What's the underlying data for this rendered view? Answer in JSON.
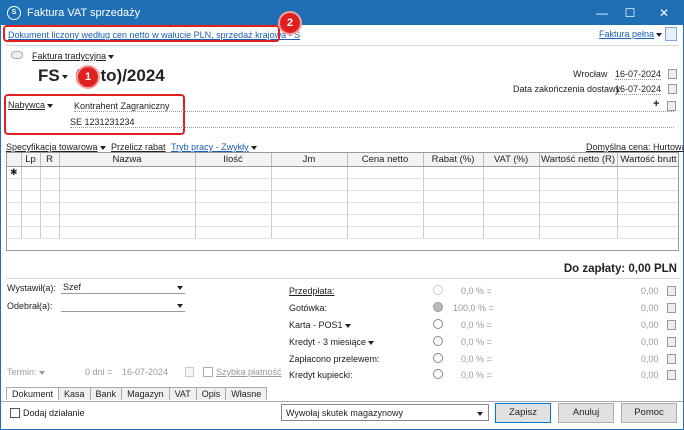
{
  "window": {
    "title": "Faktura VAT sprzedaży"
  },
  "doc_info": "Dokument liczony według cen netto w walucie PLN, sprzedaż krajowa - S",
  "faktura_pelna": "Faktura pełna",
  "faktura_tradycyjna": "Faktura tradycyjna",
  "doc_number": {
    "series": "FS",
    "number": "(auto)/2024"
  },
  "place_label": "Wrocław",
  "place_date": "16-07-2024",
  "delivery_label": "Data zakończenia dostawy",
  "delivery_date": "16-07-2024",
  "buyer": {
    "label": "Nabywca",
    "name": "Kontrahent Zagraniczny",
    "nip": "SE 1231231234"
  },
  "toolbar": {
    "spec": "Specyfikacja towarowa",
    "recalc": "Przelicz rabat",
    "mode": "Tryb pracy - Zwykły",
    "price": "Domyślna cena: Hurtowa"
  },
  "grid": {
    "columns": [
      "Lp",
      "R",
      "Nazwa",
      "Ilość",
      "Jm",
      "Cena netto",
      "Rabat (%)",
      "VAT (%)",
      "Wartość netto (R)",
      "Wartość brutt"
    ],
    "new_row_marker": "✱"
  },
  "total": "Do zapłaty: 0,00 PLN",
  "issuer": {
    "label": "Wystawił(a):",
    "value": "Szef"
  },
  "receiver": {
    "label": "Odebrał(a):",
    "value": ""
  },
  "term": {
    "label": "Termin:",
    "days": "0 dni =",
    "date": "16-07-2024",
    "fast": "Szybka płatność"
  },
  "payments": [
    {
      "label": "Przedpłata:",
      "pct": "0,0 % =",
      "amount": "0,00"
    },
    {
      "label": "Gotówka:",
      "pct": "100,0 % =",
      "amount": "0,00"
    },
    {
      "label": "Karta - POS1",
      "pct": "0,0 % =",
      "amount": "0,00"
    },
    {
      "label": "Kredyt - 3 miesiące",
      "pct": "0,0 % =",
      "amount": "0,00"
    },
    {
      "label": "Zapłacono przelewem:",
      "pct": "0,0 % =",
      "amount": "0,00"
    },
    {
      "label": "Kredyt kupiecki:",
      "pct": "0,0 % =",
      "amount": "0,00"
    }
  ],
  "tabs": [
    "Dokument",
    "Kasa",
    "Bank",
    "Magazyn",
    "VAT",
    "Opis",
    "Własne"
  ],
  "add_action": "Dodaj działanie",
  "warehouse_effect": "Wywołaj skutek magazynowy",
  "buttons": {
    "save": "Zapisz",
    "cancel": "Anuluj",
    "help": "Pomoc"
  },
  "badges": [
    "2",
    "1"
  ]
}
